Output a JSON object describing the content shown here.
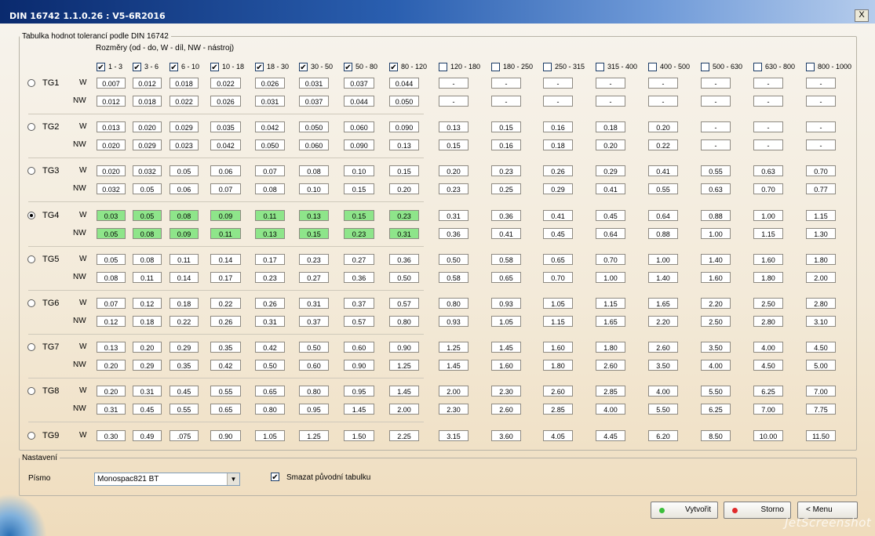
{
  "window": {
    "title": "DIN 16742 1.1.0.26 : V5-6R2016",
    "close_label": "X"
  },
  "table_group": {
    "legend": "Tabulka hodnot tolerancí podle DIN 16742",
    "subtitle": "Rozměry (od - do, W - díl, NW - nástroj)",
    "selected_group": "TG4",
    "columns": [
      {
        "label": "1 - 3",
        "checked": true
      },
      {
        "label": "3 - 6",
        "checked": true
      },
      {
        "label": "6 - 10",
        "checked": true
      },
      {
        "label": "10 - 18",
        "checked": true
      },
      {
        "label": "18 - 30",
        "checked": true
      },
      {
        "label": "30 - 50",
        "checked": true
      },
      {
        "label": "50 - 80",
        "checked": true
      },
      {
        "label": "80 - 120",
        "checked": true
      },
      {
        "label": "120 - 180",
        "checked": false
      },
      {
        "label": "180 - 250",
        "checked": false
      },
      {
        "label": "250 - 315",
        "checked": false
      },
      {
        "label": "315 - 400",
        "checked": false
      },
      {
        "label": "400 - 500",
        "checked": false
      },
      {
        "label": "500 - 630",
        "checked": false
      },
      {
        "label": "630 - 800",
        "checked": false
      },
      {
        "label": "800 - 1000",
        "checked": false
      }
    ],
    "groups": [
      {
        "name": "TG1",
        "W": [
          "0.007",
          "0.012",
          "0.018",
          "0.022",
          "0.026",
          "0.031",
          "0.037",
          "0.044",
          "-",
          "-",
          "-",
          "-",
          "-",
          "-",
          "-",
          "-"
        ],
        "NW": [
          "0.012",
          "0.018",
          "0.022",
          "0.026",
          "0.031",
          "0.037",
          "0.044",
          "0.050",
          "-",
          "-",
          "-",
          "-",
          "-",
          "-",
          "-",
          "-"
        ]
      },
      {
        "name": "TG2",
        "W": [
          "0.013",
          "0.020",
          "0.029",
          "0.035",
          "0.042",
          "0.050",
          "0.060",
          "0.090",
          "0.13",
          "0.15",
          "0.16",
          "0.18",
          "0.20",
          "-",
          "-",
          "-"
        ],
        "NW": [
          "0.020",
          "0.029",
          "0.023",
          "0.042",
          "0.050",
          "0.060",
          "0.090",
          "0.13",
          "0.15",
          "0.16",
          "0.18",
          "0.20",
          "0.22",
          "-",
          "-",
          "-"
        ]
      },
      {
        "name": "TG3",
        "W": [
          "0.020",
          "0.032",
          "0.05",
          "0.06",
          "0.07",
          "0.08",
          "0.10",
          "0.15",
          "0.20",
          "0.23",
          "0.26",
          "0.29",
          "0.41",
          "0.55",
          "0.63",
          "0.70"
        ],
        "NW": [
          "0.032",
          "0.05",
          "0.06",
          "0.07",
          "0.08",
          "0.10",
          "0.15",
          "0.20",
          "0.23",
          "0.25",
          "0.29",
          "0.41",
          "0.55",
          "0.63",
          "0.70",
          "0.77"
        ]
      },
      {
        "name": "TG4",
        "W": [
          "0.03",
          "0.05",
          "0.08",
          "0.09",
          "0.11",
          "0.13",
          "0.15",
          "0.23",
          "0.31",
          "0.36",
          "0.41",
          "0.45",
          "0.64",
          "0.88",
          "1.00",
          "1.15"
        ],
        "NW": [
          "0.05",
          "0.08",
          "0.09",
          "0.11",
          "0.13",
          "0.15",
          "0.23",
          "0.31",
          "0.36",
          "0.41",
          "0.45",
          "0.64",
          "0.88",
          "1.00",
          "1.15",
          "1.30"
        ]
      },
      {
        "name": "TG5",
        "W": [
          "0.05",
          "0.08",
          "0.11",
          "0.14",
          "0.17",
          "0.23",
          "0.27",
          "0.36",
          "0.50",
          "0.58",
          "0.65",
          "0.70",
          "1.00",
          "1.40",
          "1.60",
          "1.80"
        ],
        "NW": [
          "0.08",
          "0.11",
          "0.14",
          "0.17",
          "0.23",
          "0.27",
          "0.36",
          "0.50",
          "0.58",
          "0.65",
          "0.70",
          "1.00",
          "1.40",
          "1.60",
          "1.80",
          "2.00"
        ]
      },
      {
        "name": "TG6",
        "W": [
          "0.07",
          "0.12",
          "0.18",
          "0.22",
          "0.26",
          "0.31",
          "0.37",
          "0.57",
          "0.80",
          "0.93",
          "1.05",
          "1.15",
          "1.65",
          "2.20",
          "2.50",
          "2.80"
        ],
        "NW": [
          "0.12",
          "0.18",
          "0.22",
          "0.26",
          "0.31",
          "0.37",
          "0.57",
          "0.80",
          "0.93",
          "1.05",
          "1.15",
          "1.65",
          "2.20",
          "2.50",
          "2.80",
          "3.10"
        ]
      },
      {
        "name": "TG7",
        "W": [
          "0.13",
          "0.20",
          "0.29",
          "0.35",
          "0.42",
          "0.50",
          "0.60",
          "0.90",
          "1.25",
          "1.45",
          "1.60",
          "1.80",
          "2.60",
          "3.50",
          "4.00",
          "4.50"
        ],
        "NW": [
          "0.20",
          "0.29",
          "0.35",
          "0.42",
          "0.50",
          "0.60",
          "0.90",
          "1.25",
          "1.45",
          "1.60",
          "1.80",
          "2.60",
          "3.50",
          "4.00",
          "4.50",
          "5.00"
        ]
      },
      {
        "name": "TG8",
        "W": [
          "0.20",
          "0.31",
          "0.45",
          "0.55",
          "0.65",
          "0.80",
          "0.95",
          "1.45",
          "2.00",
          "2.30",
          "2.60",
          "2.85",
          "4.00",
          "5.50",
          "6.25",
          "7.00"
        ],
        "NW": [
          "0.31",
          "0.45",
          "0.55",
          "0.65",
          "0.80",
          "0.95",
          "1.45",
          "2.00",
          "2.30",
          "2.60",
          "2.85",
          "4.00",
          "5.50",
          "6.25",
          "7.00",
          "7.75"
        ]
      },
      {
        "name": "TG9",
        "W": [
          "0.30",
          "0.49",
          ".075",
          "0.90",
          "1.05",
          "1.25",
          "1.50",
          "2.25",
          "3.15",
          "3.60",
          "4.05",
          "4.45",
          "6.20",
          "8.50",
          "10.00",
          "11.50"
        ],
        "NW": null
      }
    ],
    "row_label_w": "W",
    "row_label_nw": "NW"
  },
  "settings": {
    "legend": "Nastavení",
    "font_label": "Písmo",
    "font_value": "Monospac821 BT",
    "delete_checked": true,
    "delete_label": "Smazat původní tabulku"
  },
  "buttons": {
    "create": {
      "label": "Vytvořit",
      "dot_color": "#3bbf3b"
    },
    "cancel": {
      "label": "Storno",
      "dot_color": "#e02a2a"
    },
    "about": {
      "label": "< Menu"
    }
  },
  "colors": {
    "highlight": "#8ee58a"
  },
  "watermark": "JetScreenshot"
}
